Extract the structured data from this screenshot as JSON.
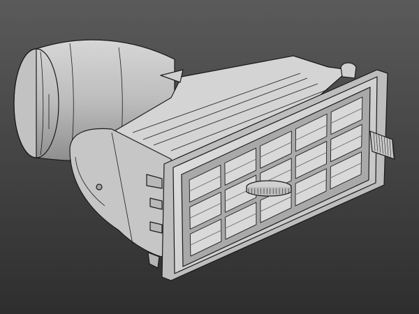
{
  "viewport": {
    "background_top": "#5a5a5a",
    "background_bottom": "#2e2e2e"
  },
  "model": {
    "subject": "car-air-vent-assembly",
    "shade_light": "#e2e2e2",
    "shade_mid": "#c8c8c8",
    "shade_dark": "#9d9d9d",
    "edge_color": "#1a1a1a"
  },
  "louvers": {
    "rows": 3,
    "columns": 5
  }
}
